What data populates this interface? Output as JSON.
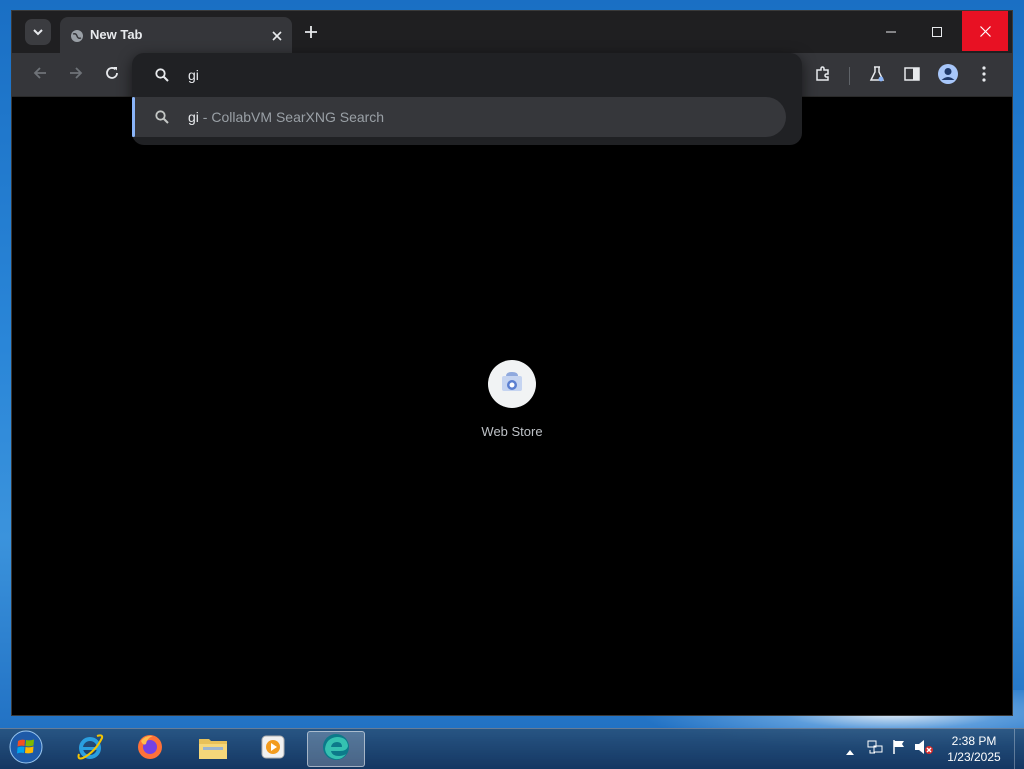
{
  "browser": {
    "tab": {
      "title": "New Tab"
    },
    "omnibox": {
      "value": "gi",
      "suggestion": {
        "query": "gi",
        "separator": " - ",
        "engine": "CollabVM SearXNG Search"
      }
    },
    "shortcuts": [
      {
        "label": "Web Store"
      }
    ],
    "colors": {
      "accent": "#8ab4f8",
      "close_button": "#e81123",
      "tab_active": "#35363a"
    }
  },
  "taskbar": {
    "apps": [
      {
        "name": "internet-explorer-icon"
      },
      {
        "name": "firefox-icon"
      },
      {
        "name": "file-explorer-icon"
      },
      {
        "name": "media-player-icon"
      },
      {
        "name": "edge-icon",
        "active": true
      }
    ],
    "clock": {
      "time": "2:38 PM",
      "date": "1/23/2025"
    }
  }
}
